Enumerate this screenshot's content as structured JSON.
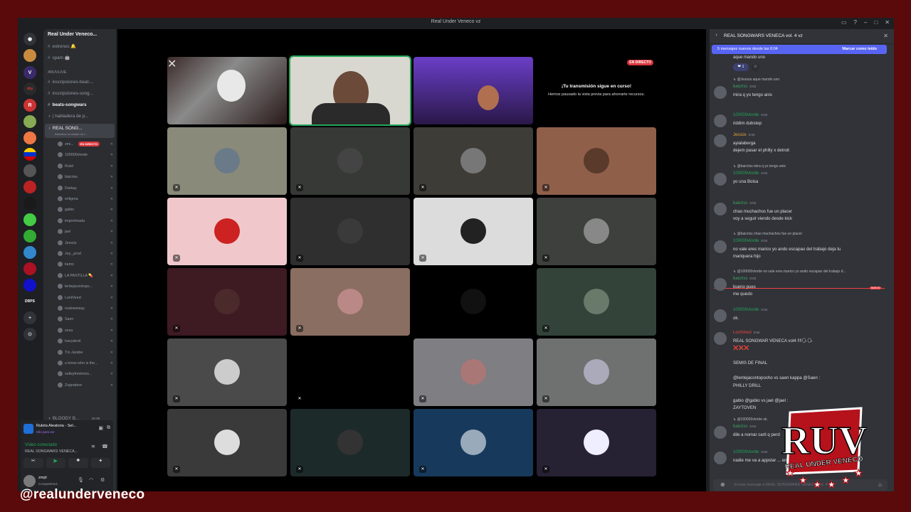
{
  "window_title": "Real Under Veneco vz",
  "server": {
    "name": "Real Under Veneco...",
    "channels": [
      {
        "label": "estrenos 🔔"
      },
      {
        "label": "spam 🤖"
      }
    ],
    "category": "#RUVLIVE",
    "live_channels": [
      {
        "label": "inscripciones-beat-..."
      },
      {
        "label": "inscripciones-song..."
      },
      {
        "label": "beats-songwars"
      },
      {
        "label": "| habladera de p..."
      }
    ],
    "voice_channel": {
      "label": "REAL SONG...",
      "status": "Establece un estado de c..."
    },
    "live_badge": "EN DIRECTO",
    "voice_users": [
      "zmi...",
      "100000vlorde",
      "Ruiel",
      "baicriss",
      "Darkay",
      "enligma",
      "gabio",
      "importmada",
      "jael",
      "Jessús",
      "Joy._prod",
      "kamo",
      "LA PASTILLA 💊",
      "lentejacontopo...",
      "LordVeed",
      "realownway",
      "Saen",
      "sosa",
      "travydevil",
      "Tío Jarabe",
      "u know who is the...",
      "valleyfreshons...",
      "Zognatore"
    ],
    "bloody": "BLOODY B...",
    "bloody_counts": [
      "00",
      "99"
    ],
    "texto": "Texto"
  },
  "activity": {
    "title": "Ruleta Aleatoria - Sel...",
    "sub": "Hilo para ver"
  },
  "voice_connected": {
    "label": "Vídeo conectado",
    "channel": "REAL SONGWARS VENECA..."
  },
  "user": {
    "name": "zmpl",
    "status": "Compartiend..."
  },
  "stream": {
    "live_badge": "EN DIRECTO",
    "paused_title": "¡Tu transmisión sigue en curso!",
    "paused_sub": "Hemos pausado la vista previa para ahorrarte recursos."
  },
  "tile_colors": [
    "#8a8a7a",
    "#373936",
    "#3d3c37",
    "#8f5f4a",
    "#f0c8cc",
    "#2e2f2e",
    "#dcdcdc",
    "#3e403e",
    "#3e1a22",
    "#8a6e62",
    "#000000",
    "#33433a",
    "#4a4a4a",
    "#000000",
    "#7f7e82",
    "#6f7070",
    "#3a3a3a",
    "#1d2a2a",
    "#173a5c",
    "#262133"
  ],
  "chat": {
    "header": "REAL SONGWARS VENECA vol. 4 vz",
    "banner_text": "5 mensajes nuevos desde las 0:04",
    "banner_action": "Marcar como leído",
    "top_line": "aque mando uno",
    "reaction_count": "1",
    "messages": [
      {
        "reply": "@Jessús aque mando uno",
        "author": "baicriss",
        "time": "0:03",
        "lines": [
          "mira q yo tengo anis"
        ]
      },
      {
        "author": "100000vlorde",
        "time": "0:03",
        "lines": [
          "riddim dubstep"
        ]
      },
      {
        "author": "Jessús",
        "time": "0:03",
        "lines": [
          "ayialaberga",
          "dejem pasar el philly x detroit"
        ]
      },
      {
        "reply": "@baicriss mira q yo tengo anis",
        "author": "100000vlorde",
        "time": "0:03",
        "lines": [
          "yo una Bolsa"
        ]
      },
      {
        "author": "baicriss",
        "time": "0:03",
        "lines": [
          "chao muchachos fue un placer",
          "voy a seguir viendo desde kick"
        ]
      },
      {
        "reply": "@baicriss chao muchachos fue un placer",
        "author": "100000vlorde",
        "time": "0:04",
        "lines": [
          "no vale eres marico yo ando escapao del trabajo deja tu",
          "mariquera hijo"
        ]
      },
      {
        "reply": "@100000vlorde no vale eres marico yo ando escapao del trabajo d...",
        "author": "baicriss",
        "time": "0:04",
        "lines": [
          "bueno pues",
          "me quedo"
        ]
      },
      {
        "author": "100000vlorde",
        "time": "0:04",
        "lines": [
          "ok."
        ]
      },
      {
        "author": "LordVeed",
        "time": "0:04",
        "lines": [
          "REAL SONGWAR VENECA vol4 ‼‼🗣🗣",
          "❌❌❌",
          "",
          "SEMIS DE FINAL",
          "",
          "@lentejacontopocho  vs saen kappa  @Saen  :",
          "PHILLY DRILL",
          "",
          "gabio  @gabio  vs jael  @jael  :",
          "ZAYTOVEN"
        ]
      },
      {
        "reply": "@100000vlorde ok.",
        "author": "baicriss",
        "time": "0:04",
        "lines": [
          "dile a nomar carti q perd"
        ]
      },
      {
        "author": "100000vlorde",
        "time": "0:04",
        "lines": [
          "nadie me va a appstar ... entonces"
        ]
      }
    ],
    "new_tag": "NUEVO",
    "input_placeholder": "Enviar mensaje a REAL SONGWARS VENECA vol. 4 vz"
  },
  "watermark": "@realunderveneco",
  "logo_text": {
    "big": "RUV",
    "small": "REAL UNDER VENECO"
  },
  "colors": {
    "frame_border": "#5a0a0a",
    "accent": "#5865f2",
    "live": "#da373c",
    "online_green": "#23a559"
  }
}
